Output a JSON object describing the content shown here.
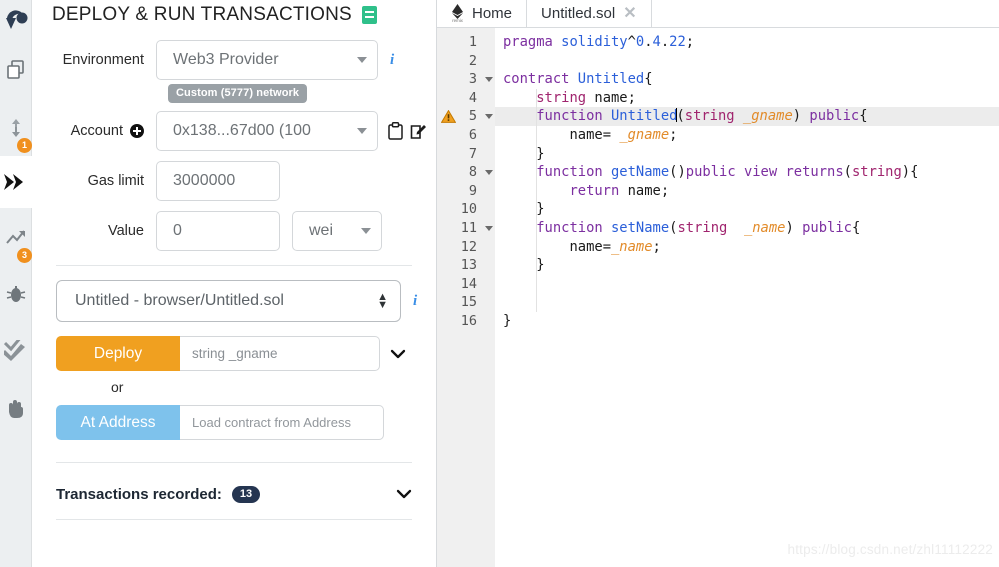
{
  "iconbar": {
    "items": [
      {
        "name": "remix-logo-icon",
        "badge": null
      },
      {
        "name": "file-explorers-icon",
        "badge": null
      },
      {
        "name": "solidity-compiler-icon",
        "badge": "1"
      },
      {
        "name": "deploy-run-transactions-icon",
        "badge": null
      },
      {
        "name": "solidity-static-analysis-icon",
        "badge": "3"
      },
      {
        "name": "debugger-icon",
        "badge": null
      },
      {
        "name": "solidity-unit-testing-icon",
        "badge": null
      },
      {
        "name": "plugin-manager-icon",
        "badge": null
      }
    ]
  },
  "panel": {
    "title": "DEPLOY & RUN TRANSACTIONS",
    "environment": {
      "label": "Environment",
      "value": "Web3 Provider",
      "network_badge": "Custom (5777) network",
      "info_char": "i"
    },
    "account": {
      "label": "Account",
      "value": "0x138...67d00 (100 ",
      "copy_icon": "clipboard-icon",
      "edit_icon": "edit-icon"
    },
    "gas_limit": {
      "label": "Gas limit",
      "value": "3000000"
    },
    "value_field": {
      "label": "Value",
      "value": "0",
      "unit": "wei"
    },
    "contract": {
      "selected": "Untitled - browser/Untitled.sol",
      "info_char": "i"
    },
    "deploy": {
      "button_label": "Deploy",
      "input_placeholder": "string _gname"
    },
    "or_label": "or",
    "at_address": {
      "button_label": "At Address",
      "input_placeholder": "Load contract from Address"
    },
    "transactions": {
      "label": "Transactions recorded:",
      "count": "13"
    }
  },
  "editor": {
    "tabs": [
      {
        "label": "Home",
        "closable": false,
        "active": false
      },
      {
        "label": "Untitled.sol",
        "closable": true,
        "active": true
      }
    ],
    "logo_caption": "remix",
    "close_glyph": "✕",
    "lines": [
      {
        "n": "1",
        "fold": false,
        "warn": false,
        "hl": false,
        "text": "pragma solidity^0.4.22;"
      },
      {
        "n": "2",
        "fold": false,
        "warn": false,
        "hl": false,
        "text": ""
      },
      {
        "n": "3",
        "fold": true,
        "warn": false,
        "hl": false,
        "text": "contract Untitled{"
      },
      {
        "n": "4",
        "fold": false,
        "warn": false,
        "hl": false,
        "text": "    string name;"
      },
      {
        "n": "5",
        "fold": true,
        "warn": true,
        "hl": true,
        "text": "    function Untitled(string _gname) public{"
      },
      {
        "n": "6",
        "fold": false,
        "warn": false,
        "hl": false,
        "text": "        name= _gname;"
      },
      {
        "n": "7",
        "fold": false,
        "warn": false,
        "hl": false,
        "text": "    }"
      },
      {
        "n": "8",
        "fold": true,
        "warn": false,
        "hl": false,
        "text": "    function getName()public view returns(string){"
      },
      {
        "n": "9",
        "fold": false,
        "warn": false,
        "hl": false,
        "text": "        return name;"
      },
      {
        "n": "10",
        "fold": false,
        "warn": false,
        "hl": false,
        "text": "    }"
      },
      {
        "n": "11",
        "fold": true,
        "warn": false,
        "hl": false,
        "text": "    function setName(string  _name) public{"
      },
      {
        "n": "12",
        "fold": false,
        "warn": false,
        "hl": false,
        "text": "        name=_name;"
      },
      {
        "n": "13",
        "fold": false,
        "warn": false,
        "hl": false,
        "text": "    }"
      },
      {
        "n": "14",
        "fold": false,
        "warn": false,
        "hl": false,
        "text": ""
      },
      {
        "n": "15",
        "fold": false,
        "warn": false,
        "hl": false,
        "text": ""
      },
      {
        "n": "16",
        "fold": false,
        "warn": false,
        "hl": false,
        "text": "}"
      }
    ]
  },
  "watermark": "https://blog.csdn.net/zhl11112222",
  "colors": {
    "accent_orange": "#f0a020",
    "accent_blue": "#7ec2ec",
    "badge_orange": "#f0901e",
    "badge_navy": "#253551",
    "doc_green": "#2fc08a",
    "info_blue": "#3a8ee6"
  }
}
